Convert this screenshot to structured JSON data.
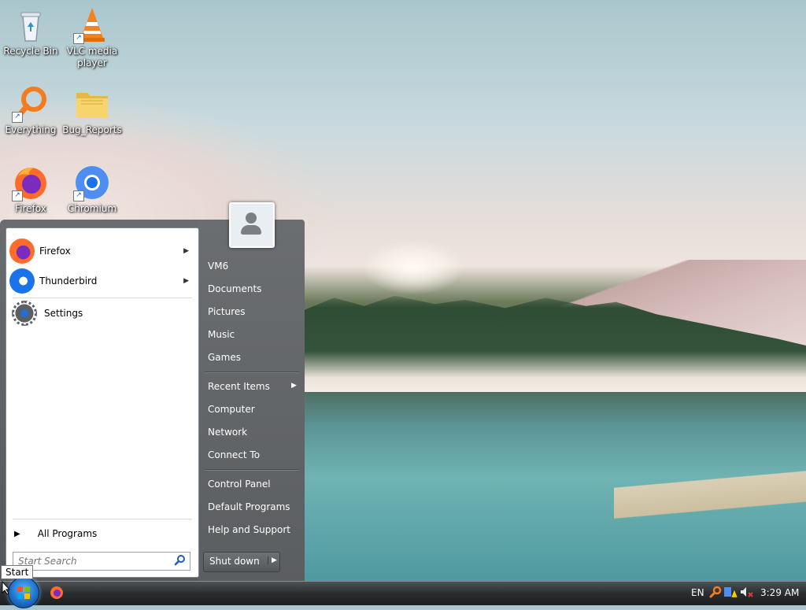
{
  "desktop": {
    "icons": [
      {
        "label": "Recycle Bin",
        "icon": "recycle-bin-icon"
      },
      {
        "label": "VLC media player",
        "icon": "vlc-icon"
      },
      {
        "label": "Everything",
        "icon": "everything-search-icon"
      },
      {
        "label": "Bug_Reports",
        "icon": "folder-icon"
      },
      {
        "label": "Firefox",
        "icon": "firefox-icon"
      },
      {
        "label": "Chromium",
        "icon": "chromium-icon"
      }
    ]
  },
  "start_menu": {
    "pinned": [
      {
        "label": "Firefox",
        "has_submenu": true
      },
      {
        "label": "Thunderbird",
        "has_submenu": true
      }
    ],
    "recent": [
      {
        "label": "Settings"
      }
    ],
    "all_programs": "All Programs",
    "search_placeholder": "Start Search",
    "right": {
      "user": "VM6",
      "documents": "Documents",
      "pictures": "Pictures",
      "music": "Music",
      "games": "Games",
      "recent_items": "Recent Items",
      "computer": "Computer",
      "network": "Network",
      "connect_to": "Connect To",
      "control_panel": "Control Panel",
      "default_programs": "Default Programs",
      "help_support": "Help and Support"
    },
    "shutdown": "Shut down",
    "tooltip": "Start"
  },
  "taskbar": {
    "language": "EN",
    "clock": "3:29 AM"
  },
  "colors": {
    "taskbar": "#2a2d30",
    "start_orb": "#1f72c9",
    "menu_right": "#5b5e61"
  }
}
